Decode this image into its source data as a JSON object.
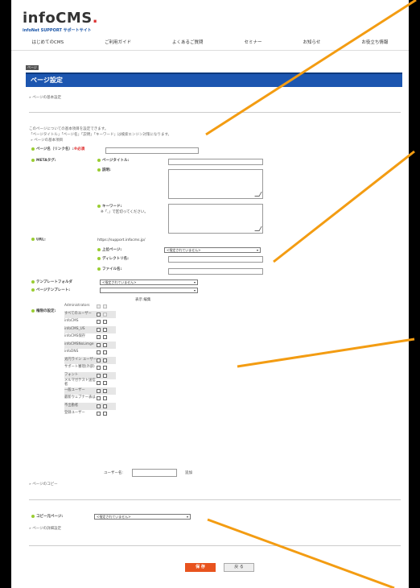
{
  "logo": {
    "main": "infoCMS",
    "dot": ".",
    "sub": "infoNet SUPPORT サポートサイト"
  },
  "nav": [
    "はじめてのCMS",
    "ご利用ガイド",
    "よくあるご質問",
    "セミナー",
    "お知らせ",
    "お役立ち情報"
  ],
  "breadcrumb": "ページ",
  "page_title": "ページ設定",
  "sections": {
    "basic": "ページの基本設定",
    "copy": "ページのコピー",
    "detail": "ページの詳細設定"
  },
  "basic_note": {
    "line1": "このページについての基本項目を設定できます。",
    "line2": "「ページタイトル」「ページ名」「説明」「キーワード」は検索エンジン対策になります。",
    "line3": "ページの基本項目"
  },
  "fields": {
    "page_name": "ページ名（リンク名）:",
    "required": "※必須",
    "meta": "METAタグ:",
    "page_title": "ページタイトル:",
    "description": "説明:",
    "keyword": "キーワード:",
    "keyword_note": "※「,」で区切ってください。",
    "url": "URL:",
    "url_value": "https://support.infocms.jp/",
    "parent_page": "上位ページ:",
    "parent_page_value": "<指定されていません>",
    "directory": "ディレクトリ名:",
    "file": "ファイル名:",
    "template_folder": "テンプレートフォルダ",
    "template_folder_value": "<指定されていません>",
    "page_template": "ページテンプレート:",
    "page_template_value": "",
    "permissions": "権限の設定:",
    "perm_headers": "表示 編集",
    "user_name": "ユーザー名:",
    "user_add": "追加",
    "copy_source": "コピー元ページ:",
    "copy_source_value": "<指定されていません>"
  },
  "permissions": [
    "Administrators",
    "すべてのユーザー",
    "infoCMS",
    "infoCMS_US",
    "infoCMS保存",
    "infoCMSNoLimge",
    "infoDNS",
    "太円ライン ユーザー",
    "サポート審理(外部)",
    "フォント",
    "メルマガテスト送信者",
    "一般ユーザー",
    "最新ウェブナー表は",
    "不出勤者",
    "登録ユーザー"
  ],
  "buttons": {
    "save": "保 存",
    "back": "戻 る"
  },
  "colors": {
    "accent": "#1c56b0",
    "save": "#e8531e",
    "annotation": "#f39c12"
  }
}
